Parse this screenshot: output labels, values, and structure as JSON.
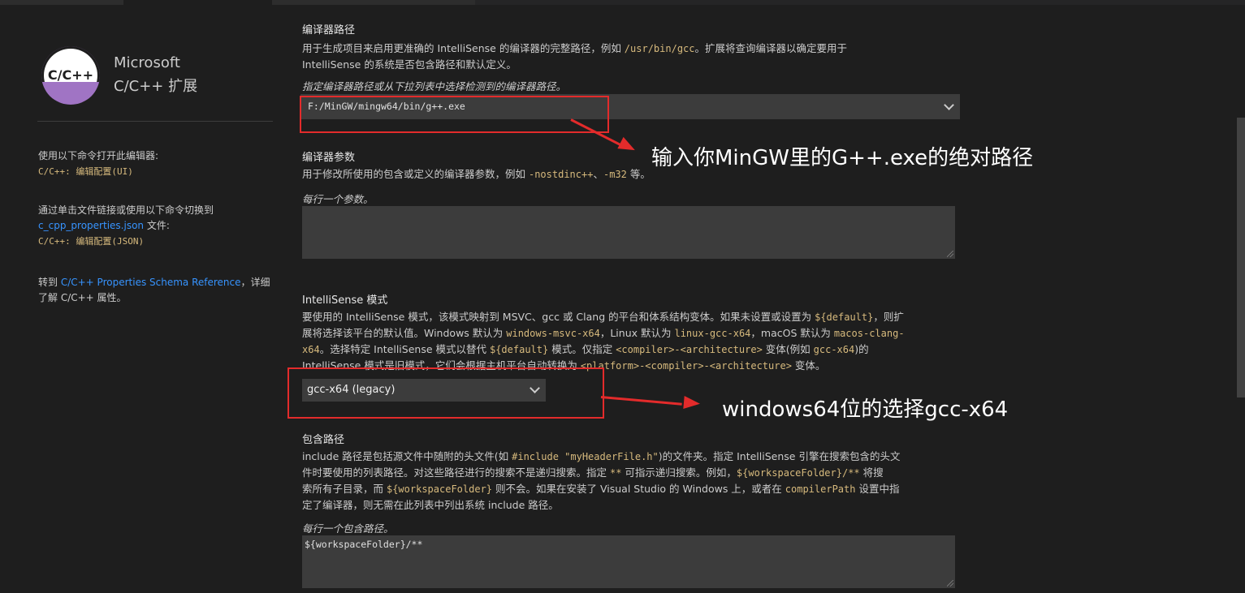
{
  "extension": {
    "logo_text": "C/C++",
    "name_line1": "Microsoft",
    "name_line2": "C/C++ 扩展"
  },
  "sidebar": {
    "open_editor_text": "使用以下命令打开此编辑器:",
    "open_editor_cmd": "C/C++: 编辑配置(UI)",
    "switch_text": "通过单击文件链接或使用以下命令切换到",
    "switch_link": "c_cpp_properties.json",
    "switch_suffix": " 文件:",
    "switch_cmd": "C/C++: 编辑配置(JSON)",
    "goto_prefix": "转到 ",
    "goto_link": "C/C++ Properties Schema Reference",
    "goto_suffix": "，详细",
    "goto_line2": "了解 C/C++ 属性。"
  },
  "compiler_path": {
    "title": "编译器路径",
    "desc_1": "用于生成项目来启用更准确的 IntelliSense 的编译器的完整路径，例如 ",
    "desc_code": "/usr/bin/gcc",
    "desc_2": "。扩展将查询编译器以确定要用于",
    "desc_3": "IntelliSense 的系统是否包含路径和默认定义。",
    "hint": "指定编译器路径或从下拉列表中选择检测到的编译器路径。",
    "value": "F:/MinGW/mingw64/bin/g++.exe"
  },
  "compiler_args": {
    "title": "编译器参数",
    "desc_1": "用于修改所使用的包含或定义的编译器参数，例如 ",
    "code_1": "-nostdinc++",
    "sep": "、",
    "code_2": "-m32",
    "desc_2": " 等。",
    "hint": "每行一个参数。",
    "value": ""
  },
  "intellisense_mode": {
    "title": "IntelliSense 模式",
    "l1_a": "要使用的 IntelliSense 模式，该模式映射到 MSVC、gcc 或 Clang 的平台和体系结构变体。如果未设置或设置为 ",
    "l1_code": "${default}",
    "l1_b": "，则扩",
    "l2_a": "展将选择该平台的默认值。Windows 默认为 ",
    "l2_code1": "windows-msvc-x64",
    "l2_b": "，Linux 默认为 ",
    "l2_code2": "linux-gcc-x64",
    "l2_c": "，macOS 默认为 ",
    "l2_code3": "macos-clang-",
    "l3_code0": "x64",
    "l3_a": "。选择特定 IntelliSense 模式以替代 ",
    "l3_code1": "${default}",
    "l3_b": " 模式。仅指定 ",
    "l3_code2": "<compiler>-<architecture>",
    "l3_c": " 变体(例如 ",
    "l3_code3": "gcc-x64",
    "l3_d": ")的",
    "l4_a": "IntelliSense 模式是旧模式，它们会根据主机平台自动转换为 ",
    "l4_code": "<platform>-<compiler>-<architecture>",
    "l4_b": " 变体。",
    "selected": "gcc-x64 (legacy)"
  },
  "include_path": {
    "title": "包含路径",
    "l1_a": "include 路径是包括源文件中随附的头文件(如 ",
    "l1_code": "#include \"myHeaderFile.h\"",
    "l1_b": ")的文件夹。指定 IntelliSense 引擎在搜索包含的头文",
    "l2_a": "件时要使用的列表路径。对这些路径进行的搜索不是递归搜索。指定 ",
    "l2_code1": "**",
    "l2_b": " 可指示递归搜索。例如，",
    "l2_code2": "${workspaceFolder}/**",
    "l2_c": " 将搜",
    "l3_a": "索所有子目录，而 ",
    "l3_code": "${workspaceFolder}",
    "l3_b": " 则不会。如果在安装了 Visual Studio 的 Windows 上，或者在 ",
    "l3_code2": "compilerPath",
    "l3_c": " 设置中指",
    "l4": "定了编译器，则无需在此列表中列出系统 include 路径。",
    "hint": "每行一个包含路径。",
    "value": "${workspaceFolder}/**"
  },
  "annotations": {
    "note_1": "输入你MinGW里的G++.exe的绝对路径",
    "note_2": "windows64位的选择gcc-x64"
  },
  "colors": {
    "background": "#1e1e1e",
    "input_bg": "#3c3c3c",
    "link": "#3794ff",
    "code": "#d7ba7d",
    "annotation_red": "#e32b2b"
  }
}
